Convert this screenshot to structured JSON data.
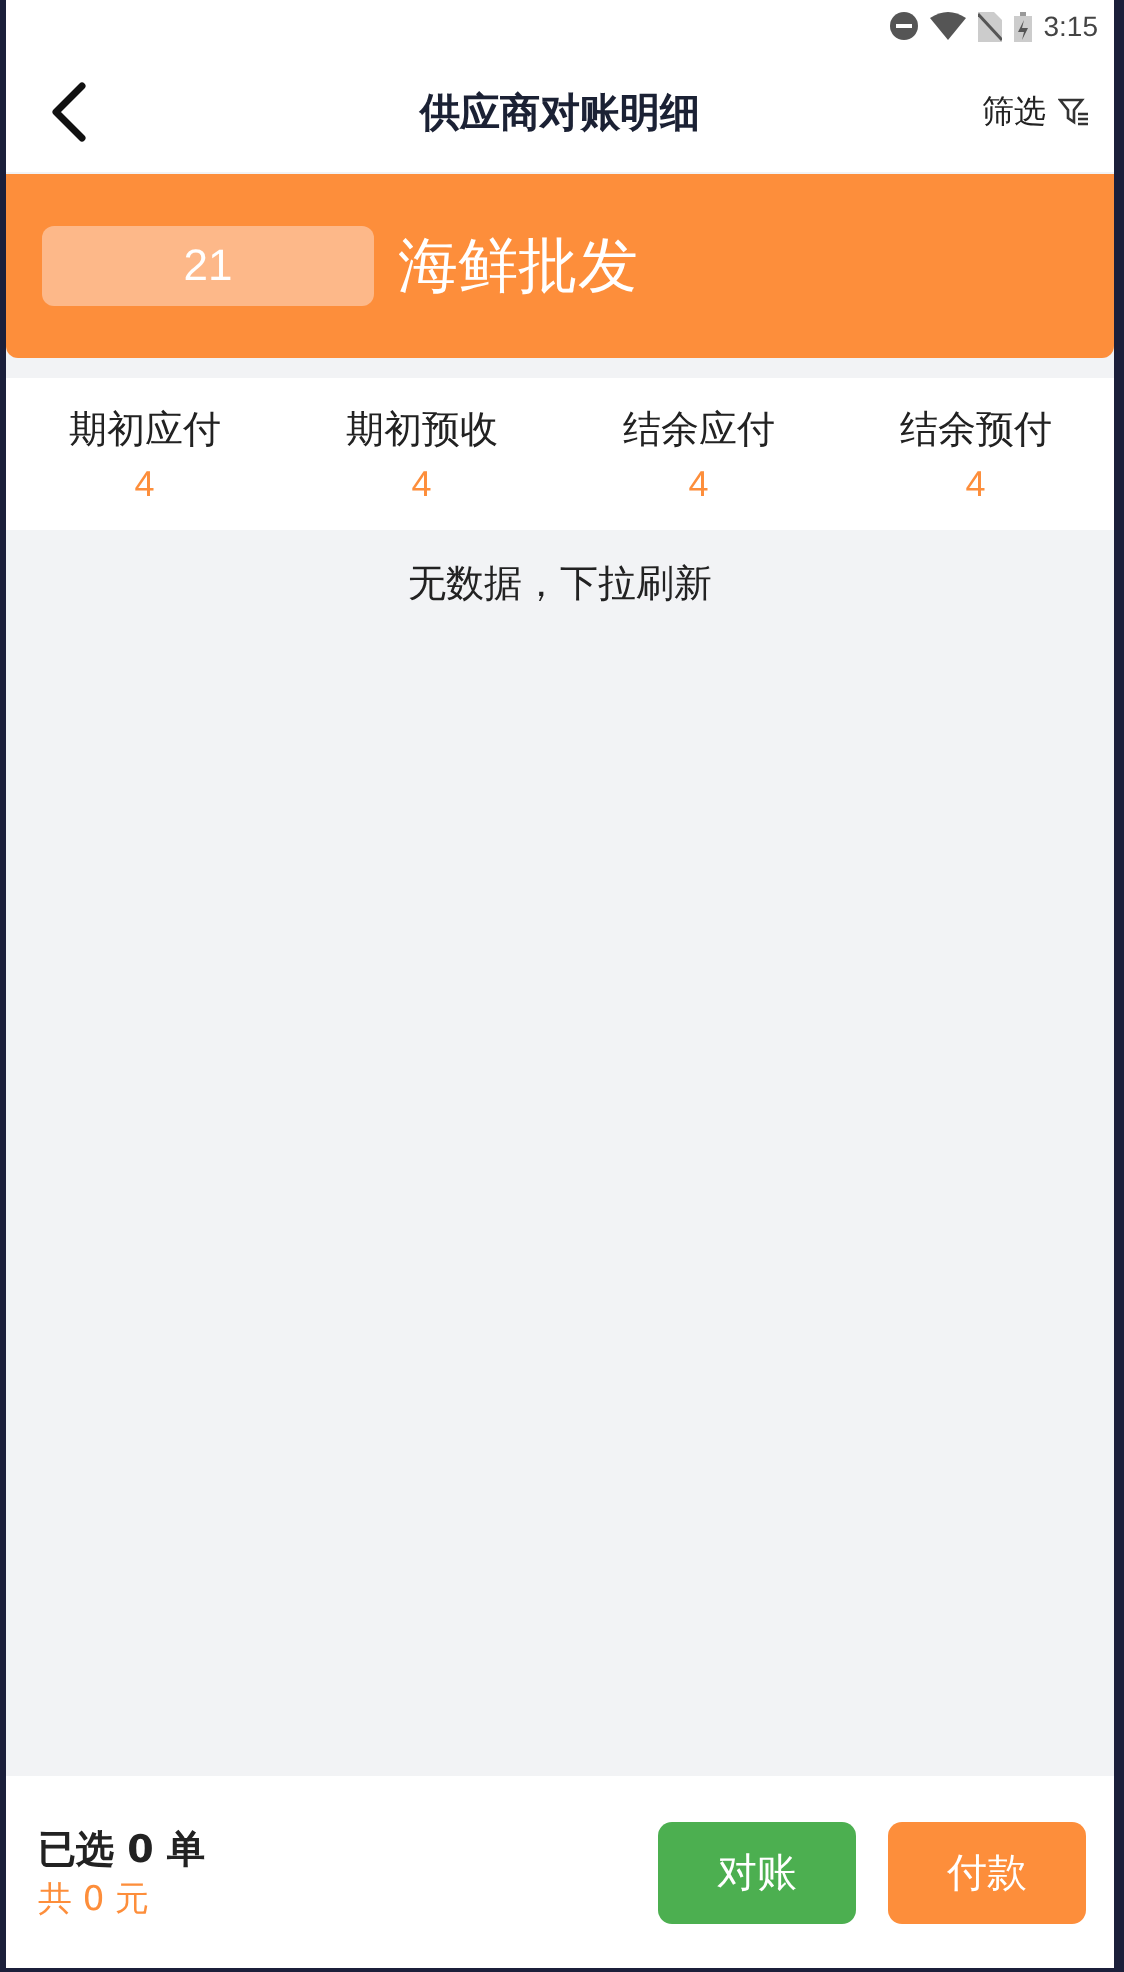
{
  "status_bar": {
    "time": "3:15"
  },
  "header": {
    "title": "供应商对账明细",
    "filter_label": "筛选"
  },
  "supplier": {
    "code": "21",
    "name": "海鲜批发"
  },
  "summary": [
    {
      "label": "期初应付",
      "value": "4"
    },
    {
      "label": "期初预收",
      "value": "4"
    },
    {
      "label": "结余应付",
      "value": "4"
    },
    {
      "label": "结余预付",
      "value": "4"
    }
  ],
  "empty_message": "无数据，下拉刷新",
  "footer": {
    "selected_count": "已选 0 单",
    "total": "共 0 元",
    "buttons": [
      {
        "label": "对账",
        "kind": "reconcile"
      },
      {
        "label": "付款",
        "kind": "pay"
      }
    ]
  }
}
